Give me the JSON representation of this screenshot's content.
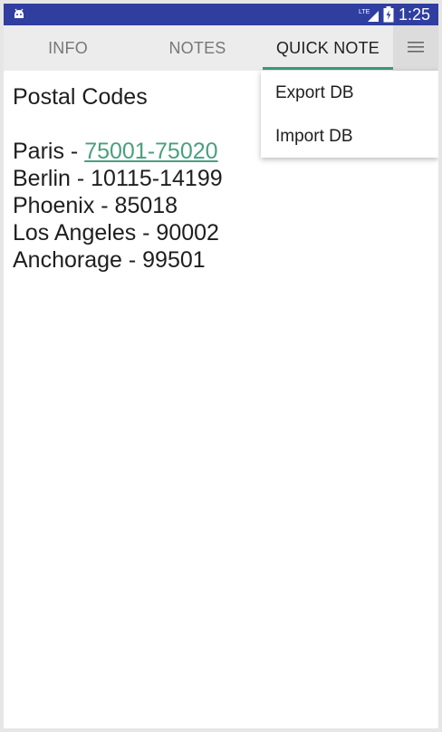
{
  "status_bar": {
    "time": "1:25",
    "network": "LTE"
  },
  "tabs": [
    {
      "label": "INFO"
    },
    {
      "label": "NOTES"
    },
    {
      "label": "QUICK NOTE"
    }
  ],
  "active_tab": "QUICK NOTE",
  "menu": {
    "icon": "menu-icon",
    "items": [
      {
        "label": "Export DB"
      },
      {
        "label": "Import DB"
      }
    ]
  },
  "note": {
    "title": "Postal Codes",
    "lines": [
      {
        "city": "Paris",
        "separator": " - ",
        "code": "75001-75020",
        "is_link": true
      },
      {
        "text": "Berlin - 10115-14199"
      },
      {
        "text": "Phoenix - 85018"
      },
      {
        "text": "Los Angeles - 90002"
      },
      {
        "text": "Anchorage - 99501"
      }
    ]
  },
  "colors": {
    "status_bar": "#303f9f",
    "tab_bar": "#ececec",
    "accent": "#3a9b7a",
    "link": "#4a9f7e"
  }
}
